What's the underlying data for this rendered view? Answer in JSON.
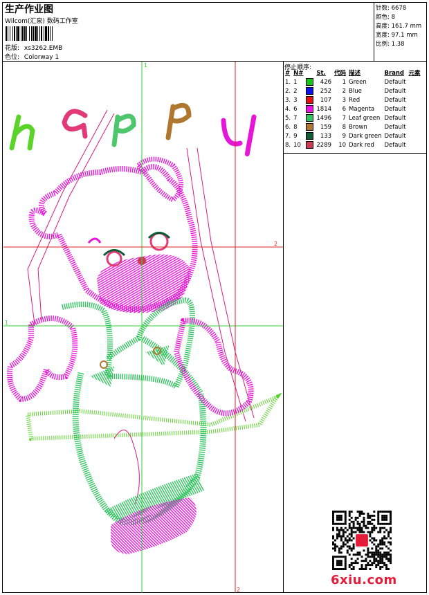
{
  "header": {
    "title": "生产作业图",
    "subtitle": "Wilcom(汇泉) 数码工作室",
    "design_label": "花版:",
    "design_file": "xs3262.EMB",
    "colorway_label": "色位:",
    "colorway": "Colorway 1"
  },
  "stats": {
    "stitches_label": "针数:",
    "stitches": "6678",
    "colors_label": "颜色:",
    "colors": "8",
    "height_label": "高度:",
    "height": "161.7 mm",
    "width_label": "宽度:",
    "width": "97.1 mm",
    "ratio_label": "比例:",
    "ratio": "1.38"
  },
  "color_table": {
    "title": "停止顺序:",
    "headers": [
      "#",
      "N#",
      "St.",
      "代码",
      "描述",
      "Brand",
      "元素"
    ],
    "rows": [
      {
        "idx": "1.",
        "n": "1",
        "color": "#16c516",
        "st": "426",
        "code": "1",
        "desc": "Green",
        "brand": "Default"
      },
      {
        "idx": "2.",
        "n": "2",
        "color": "#0a12e6",
        "st": "252",
        "code": "2",
        "desc": "Blue",
        "brand": "Default"
      },
      {
        "idx": "3.",
        "n": "3",
        "color": "#e80f0f",
        "st": "107",
        "code": "3",
        "desc": "Red",
        "brand": "Default"
      },
      {
        "idx": "4.",
        "n": "6",
        "color": "#ec12e4",
        "st": "1814",
        "code": "6",
        "desc": "Magenta",
        "brand": "Default"
      },
      {
        "idx": "5.",
        "n": "7",
        "color": "#2fc45e",
        "st": "1496",
        "code": "7",
        "desc": "Leaf green",
        "brand": "Default"
      },
      {
        "idx": "6.",
        "n": "8",
        "color": "#b0782f",
        "st": "159",
        "code": "8",
        "desc": "Brown",
        "brand": "Default"
      },
      {
        "idx": "7.",
        "n": "9",
        "color": "#0f5c35",
        "st": "133",
        "code": "9",
        "desc": "Dark green",
        "brand": "Default"
      },
      {
        "idx": "8.",
        "n": "10",
        "color": "#cc3b55",
        "st": "2289",
        "code": "10",
        "desc": "Dark red",
        "brand": "Default"
      }
    ]
  },
  "canvas": {
    "marker_top": "1",
    "marker_left": "1",
    "marker_right": "2",
    "marker_bottom": "2",
    "word": "happy"
  },
  "brand_logo": "6xiu.com",
  "accent_green": "#22c52f",
  "accent_magenta": "#e616d8",
  "guide_green": "#2ed12e",
  "guide_red": "#e02020"
}
